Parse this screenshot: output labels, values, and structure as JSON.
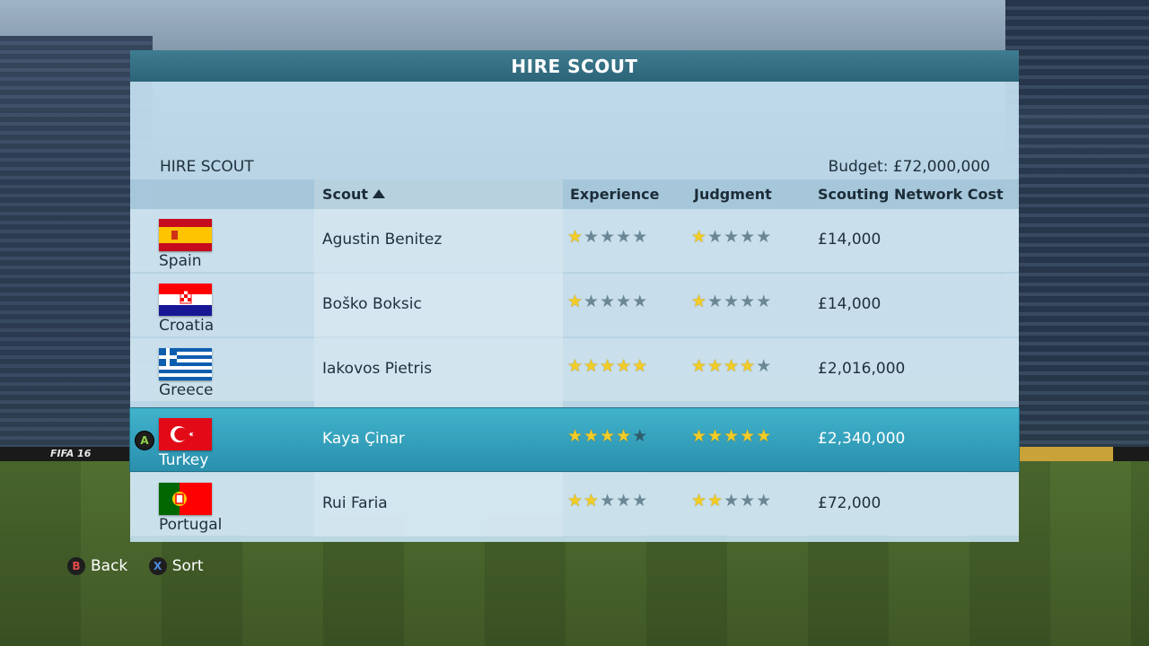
{
  "background": {
    "ad_text": "FIFA 16"
  },
  "panel": {
    "title": "HIRE SCOUT",
    "subtitle": "HIRE SCOUT",
    "budget": "Budget: £72,000,000"
  },
  "columns": {
    "scout": "Scout",
    "experience": "Experience",
    "judgment": "Judgment",
    "cost": "Scouting Network Cost"
  },
  "rows": [
    {
      "country": "Spain",
      "flag": "spain-flag",
      "name": "Agustin Benitez",
      "experience": 1,
      "judgment": 1,
      "cost": "£14,000",
      "selected": false
    },
    {
      "country": "Croatia",
      "flag": "croatia-flag",
      "name": "Boško Boksic",
      "experience": 1,
      "judgment": 1,
      "cost": "£14,000",
      "selected": false
    },
    {
      "country": "Greece",
      "flag": "greece-flag",
      "name": "Iakovos Pietris",
      "experience": 5,
      "judgment": 4,
      "cost": "£2,016,000",
      "selected": false
    },
    {
      "country": "Turkey",
      "flag": "turkey-flag",
      "name": "Kaya Çinar",
      "experience": 4,
      "judgment": 5,
      "cost": "£2,340,000",
      "selected": true
    },
    {
      "country": "Portugal",
      "flag": "portugal-flag",
      "name": "Rui Faria",
      "experience": 2,
      "judgment": 2,
      "cost": "£72,000",
      "selected": false
    }
  ],
  "select_button": "A",
  "footer": {
    "back_button": "B",
    "back_label": "Back",
    "sort_button": "X",
    "sort_label": "Sort"
  },
  "colors": {
    "header": "#2c6478",
    "selected_row": "#2a90ad",
    "star_on": "#f2cc27",
    "star_off": "#6b8796"
  }
}
